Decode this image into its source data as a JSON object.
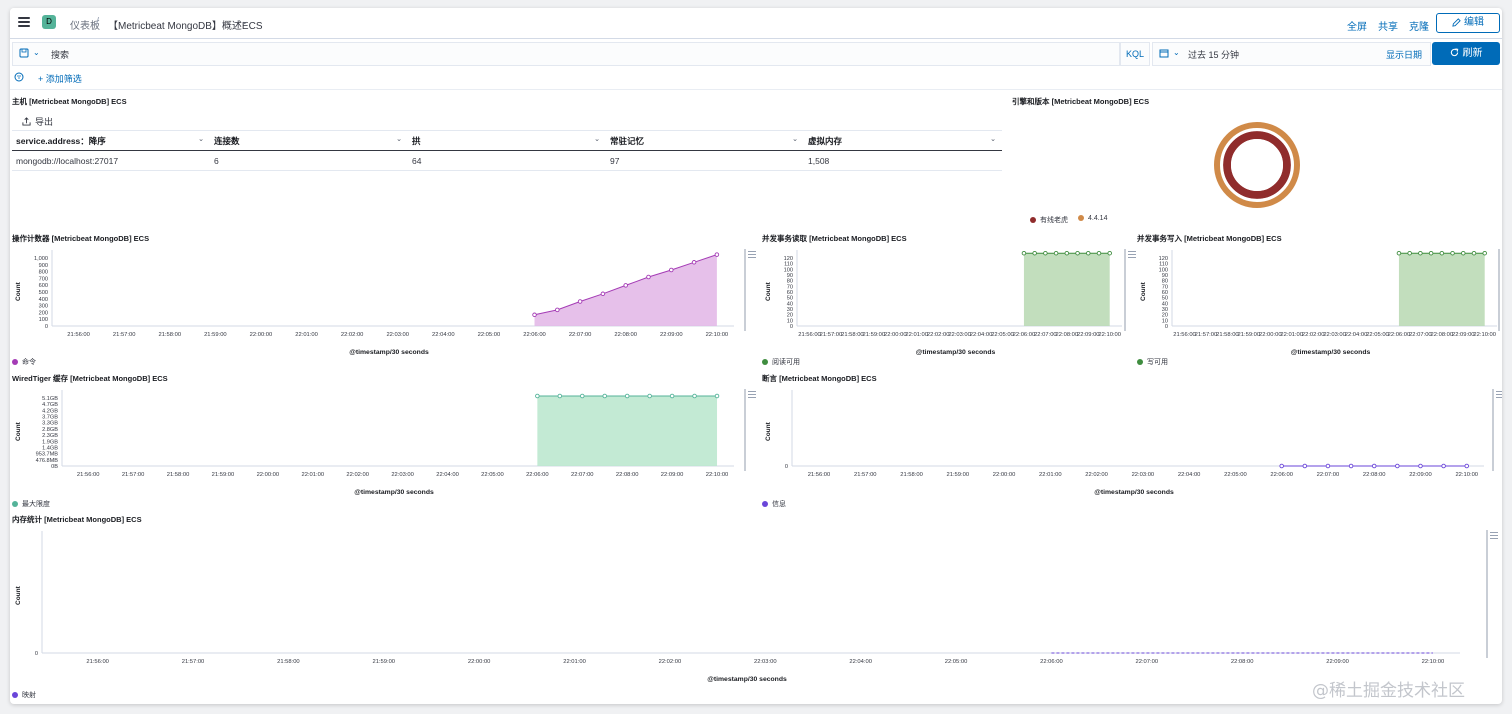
{
  "topbar": {
    "space_initial": "D",
    "breadcrumb_root": "仪表板",
    "breadcrumb_sep": "/",
    "dashboard_title": "【Metricbeat MongoDB】概述ECS",
    "fullscreen": "全屏",
    "share": "共享",
    "clone": "克隆",
    "edit": "编辑"
  },
  "query": {
    "placeholder": "搜索",
    "language": "KQL",
    "time_range": "过去 15 分钟",
    "show_dates": "显示日期",
    "refresh": "刷新",
    "add_filter": "+ 添加筛选"
  },
  "colors": {
    "accent": "#006bb8",
    "command": "#a43bb5",
    "green": "#54b399",
    "purple": "#6a46d9"
  },
  "table_panel": {
    "title": "主机 [Metricbeat MongoDB] ECS",
    "export_label": "导出",
    "columns": [
      "service.address：降序",
      "连接数",
      "拱",
      "常驻记忆",
      "虚拟内存"
    ],
    "rows": [
      [
        "mongodb://localhost:27017",
        "6",
        "64",
        "97",
        "1,508"
      ]
    ]
  },
  "engine_panel": {
    "title": "引擎和版本 [Metricbeat MongoDB] ECS",
    "chart_data": {
      "type": "pie",
      "title": "引擎和版本 [Metricbeat MongoDB] ECS",
      "rings": [
        {
          "name": "有线老虎",
          "color": "#902c2c",
          "value": 1
        },
        {
          "name": "4.4.14",
          "color": "#d08a48",
          "value": 1
        }
      ]
    }
  },
  "x_ticks": [
    "21:56:00",
    "21:57:00",
    "21:58:00",
    "21:59:00",
    "22:00:00",
    "22:01:00",
    "22:02:00",
    "22:03:00",
    "22:04:00",
    "22:05:00",
    "22:06:00",
    "22:07:00",
    "22:08:00",
    "22:09:00",
    "22:10:00"
  ],
  "panels": [
    {
      "id": "ops",
      "title": "操作计数器 [Metricbeat MongoDB] ECS",
      "legend": "命令",
      "chart_data": {
        "type": "area",
        "title": "操作计数器 [Metricbeat MongoDB] ECS",
        "xlabel": "@timestamp/30 seconds",
        "ylabel": "Count",
        "y_ticks": [
          "1,000",
          "900",
          "800",
          "700",
          "600",
          "500",
          "400",
          "300",
          "200",
          "100",
          "0"
        ],
        "ylim": [
          0,
          1000
        ],
        "series": [
          {
            "name": "命令",
            "color": "#a43bb5",
            "fill": "#e2b5e6",
            "x": [
              "22:06:00",
              "22:06:30",
              "22:07:00",
              "22:07:30",
              "22:08:00",
              "22:08:30",
              "22:09:00",
              "22:09:30",
              "22:10:00"
            ],
            "values": [
              160,
              230,
              350,
              460,
              580,
              700,
              800,
              910,
              1020
            ]
          }
        ]
      }
    },
    {
      "id": "read",
      "title": "并发事务读取 [Metricbeat MongoDB] ECS",
      "legend": "阅读可用",
      "chart_data": {
        "type": "area",
        "title": "并发事务读取 [Metricbeat MongoDB] ECS",
        "xlabel": "@timestamp/30 seconds",
        "ylabel": "Count",
        "y_ticks": [
          "120",
          "110",
          "100",
          "90",
          "80",
          "70",
          "60",
          "50",
          "40",
          "30",
          "20",
          "10",
          "0"
        ],
        "ylim": [
          0,
          120
        ],
        "series": [
          {
            "name": "阅读可用",
            "color": "#3f8d3f",
            "fill": "#b7d8b2",
            "x": [
              "22:06:00",
              "22:06:30",
              "22:07:00",
              "22:07:30",
              "22:08:00",
              "22:08:30",
              "22:09:00",
              "22:09:30",
              "22:10:00"
            ],
            "values": [
              127,
              127,
              127,
              127,
              127,
              127,
              127,
              127,
              127
            ]
          }
        ]
      }
    },
    {
      "id": "write",
      "title": "并发事务写入 [Metricbeat MongoDB] ECS",
      "legend": "写可用",
      "chart_data": {
        "type": "area",
        "title": "并发事务写入 [Metricbeat MongoDB] ECS",
        "xlabel": "@timestamp/30 seconds",
        "ylabel": "Count",
        "y_ticks": [
          "120",
          "110",
          "100",
          "90",
          "80",
          "70",
          "60",
          "50",
          "40",
          "30",
          "20",
          "10",
          "0"
        ],
        "ylim": [
          0,
          120
        ],
        "series": [
          {
            "name": "写可用",
            "color": "#3f8d3f",
            "fill": "#b7d8b2",
            "x": [
              "22:06:00",
              "22:06:30",
              "22:07:00",
              "22:07:30",
              "22:08:00",
              "22:08:30",
              "22:09:00",
              "22:09:30",
              "22:10:00"
            ],
            "values": [
              127,
              127,
              127,
              127,
              127,
              127,
              127,
              127,
              127
            ]
          }
        ]
      }
    },
    {
      "id": "wiredtiger",
      "title": "WiredTiger 缓存 [Metricbeat MongoDB] ECS",
      "legend": "最大限度",
      "chart_data": {
        "type": "area",
        "title": "WiredTiger 缓存 [Metricbeat MongoDB] ECS",
        "xlabel": "@timestamp/30 seconds",
        "ylabel": "Count",
        "y_ticks": [
          "5.1GB",
          "4.7GB",
          "4.2GB",
          "3.7GB",
          "3.3GB",
          "2.8GB",
          "2.3GB",
          "1.9GB",
          "1.4GB",
          "953.7MB",
          "476.8MB",
          "0B"
        ],
        "ylim": [
          0,
          11
        ],
        "series": [
          {
            "name": "最大限度",
            "color": "#54b399",
            "fill": "#b8e6cc",
            "x": [
              "22:06:00",
              "22:06:30",
              "22:07:00",
              "22:07:30",
              "22:08:00",
              "22:08:30",
              "22:09:00",
              "22:09:30",
              "22:10:00"
            ],
            "values": [
              11,
              11,
              11,
              11,
              11,
              11,
              11,
              11,
              11
            ]
          }
        ]
      }
    },
    {
      "id": "asserts",
      "title": "断言 [Metricbeat MongoDB] ECS",
      "legend": "信息",
      "chart_data": {
        "type": "line",
        "title": "断言 [Metricbeat MongoDB] ECS",
        "xlabel": "@timestamp/30 seconds",
        "ylabel": "Count",
        "y_ticks": [
          "0"
        ],
        "ylim": [
          0,
          10
        ],
        "series": [
          {
            "name": "信息",
            "color": "#6a46d9",
            "fill": "",
            "x": [
              "22:06:00",
              "22:06:30",
              "22:07:00",
              "22:07:30",
              "22:08:00",
              "22:08:30",
              "22:09:00",
              "22:09:30",
              "22:10:00"
            ],
            "values": [
              0,
              0,
              0,
              0,
              0,
              0,
              0,
              0,
              0
            ]
          }
        ]
      }
    },
    {
      "id": "memory",
      "title": "内存统计 [Metricbeat MongoDB] ECS",
      "legend": "映射",
      "chart_data": {
        "type": "line",
        "title": "内存统计 [Metricbeat MongoDB] ECS",
        "xlabel": "@timestamp/30 seconds",
        "ylabel": "Count",
        "y_ticks": [
          "0"
        ],
        "ylim": [
          0,
          10
        ],
        "series": [
          {
            "name": "映射",
            "color": "#6a46d9",
            "fill": "",
            "dashed": true,
            "x": [
              "22:06:00",
              "22:06:30",
              "22:07:00",
              "22:07:30",
              "22:08:00",
              "22:08:30",
              "22:09:00",
              "22:09:30",
              "22:10:00"
            ],
            "values": [
              0,
              0,
              0,
              0,
              0,
              0,
              0,
              0,
              0
            ]
          }
        ]
      }
    }
  ],
  "watermark": "@稀土掘金技术社区"
}
